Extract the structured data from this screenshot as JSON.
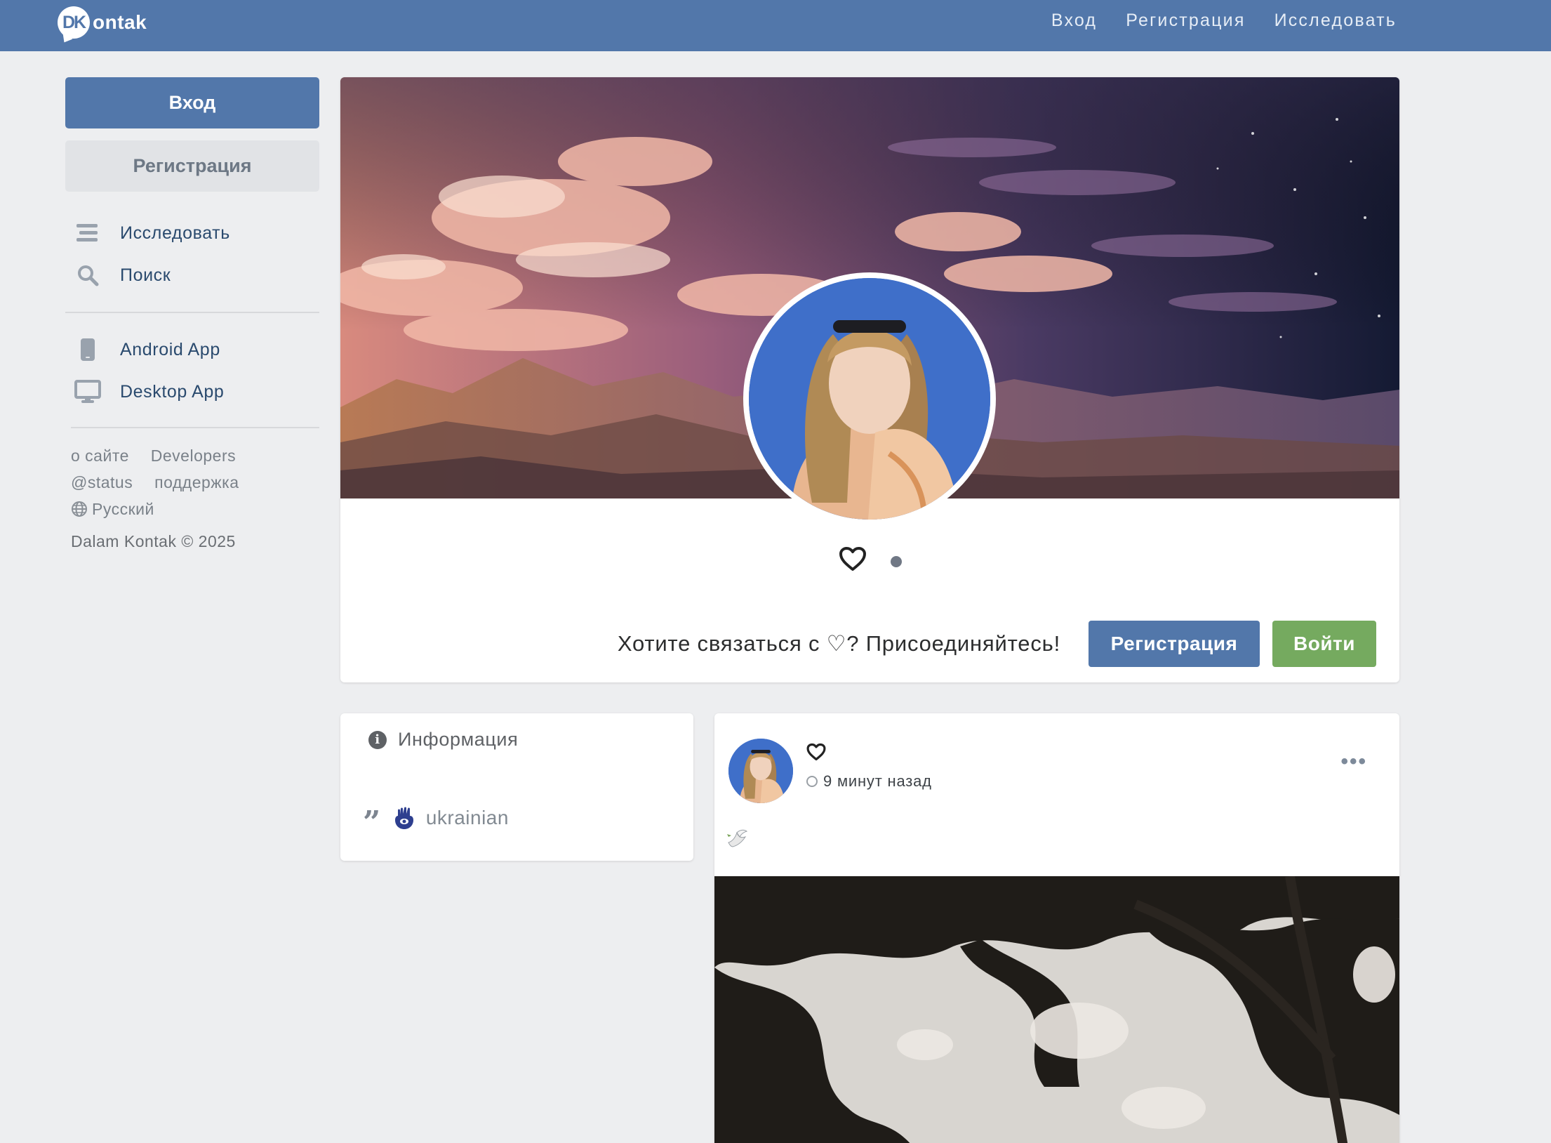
{
  "topbar": {
    "logo_badge": "DK",
    "logo_text": "ontak",
    "nav": [
      "Вход",
      "Регистрация",
      "Исследовать"
    ],
    "bg_color": "#5277aa"
  },
  "sidebar": {
    "login_label": "Вход",
    "register_label": "Регистрация",
    "menu": [
      {
        "label": "Исследовать",
        "icon": "list-icon"
      },
      {
        "label": "Поиск",
        "icon": "search-icon"
      },
      {
        "label": "Android App",
        "icon": "phone-icon"
      },
      {
        "label": "Desktop App",
        "icon": "monitor-icon"
      }
    ],
    "footer": {
      "about": "о сайте",
      "developers": "Developers",
      "status": "@status",
      "support": "поддержка",
      "language": "Русский"
    },
    "copyright": "Dalam Kontak © 2025"
  },
  "profile": {
    "name_icon": "heart-icon",
    "online": true,
    "join_text": "Хотите связаться с ♡? Присоединяйтесь!",
    "register_button": "Регистрация",
    "login_button": "Войти",
    "register_color": "#5277aa",
    "login_color": "#75aa5f"
  },
  "info": {
    "title": "Информация",
    "quote": "ukrainian",
    "quote_icon": "hamsa-icon"
  },
  "post": {
    "author_icon": "heart-icon",
    "time": "9 минут назад",
    "text_icon": "dove-icon",
    "menu_icon": "more-icon"
  }
}
